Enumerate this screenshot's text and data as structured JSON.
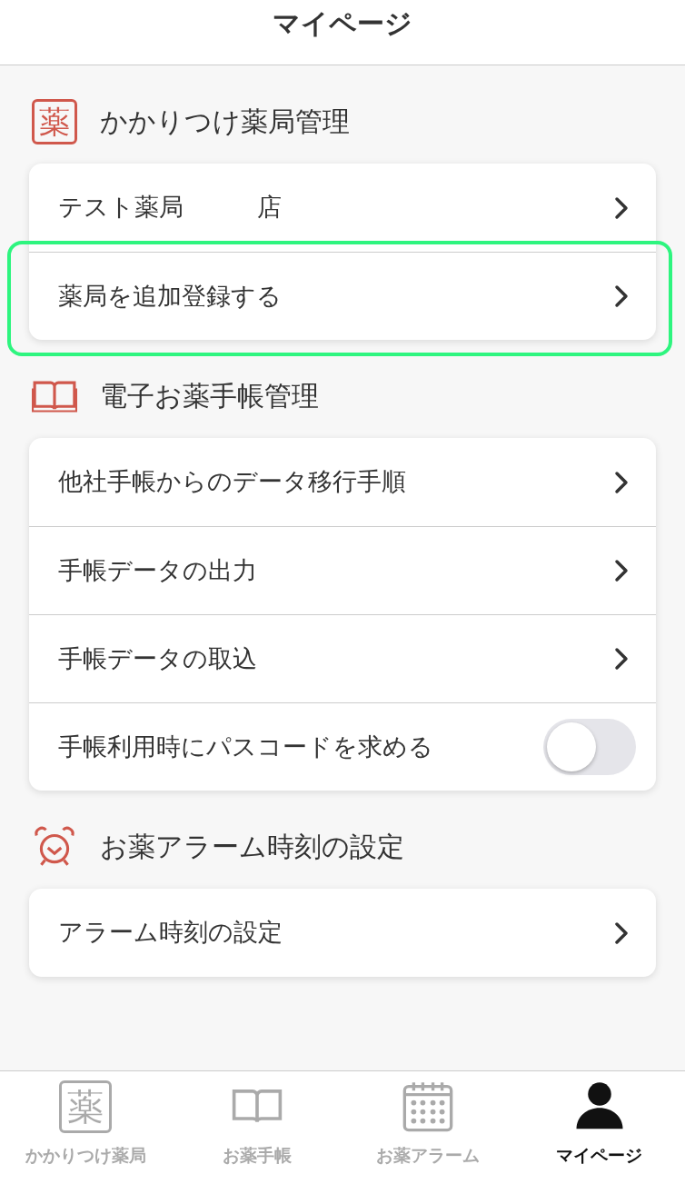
{
  "header": {
    "title": "マイページ"
  },
  "sections": [
    {
      "icon": {
        "kind": "kanji",
        "text": "薬"
      },
      "title": "かかりつけ薬局管理",
      "items": [
        {
          "kind": "link",
          "label": "テスト薬局　　　店",
          "highlighted": false
        },
        {
          "kind": "link",
          "label": "薬局を追加登録する",
          "highlighted": true
        }
      ]
    },
    {
      "icon": {
        "kind": "book"
      },
      "title": "電子お薬手帳管理",
      "items": [
        {
          "kind": "link",
          "label": "他社手帳からのデータ移行手順",
          "highlighted": false
        },
        {
          "kind": "link",
          "label": "手帳データの出力",
          "highlighted": false
        },
        {
          "kind": "link",
          "label": "手帳データの取込",
          "highlighted": false
        },
        {
          "kind": "toggle",
          "label": "手帳利用時にパスコードを求める",
          "on": false,
          "highlighted": false
        }
      ]
    },
    {
      "icon": {
        "kind": "alarm"
      },
      "title": "お薬アラーム時刻の設定",
      "items": [
        {
          "kind": "link",
          "label": "アラーム時刻の設定",
          "highlighted": false
        }
      ]
    }
  ],
  "tabs": [
    {
      "icon": {
        "kind": "kanji",
        "text": "薬"
      },
      "label": "かかりつけ薬局",
      "selected": false
    },
    {
      "icon": {
        "kind": "book"
      },
      "label": "お薬手帳",
      "selected": false
    },
    {
      "icon": {
        "kind": "calendar"
      },
      "label": "お薬アラーム",
      "selected": false
    },
    {
      "icon": {
        "kind": "person"
      },
      "label": "マイページ",
      "selected": true
    }
  ]
}
